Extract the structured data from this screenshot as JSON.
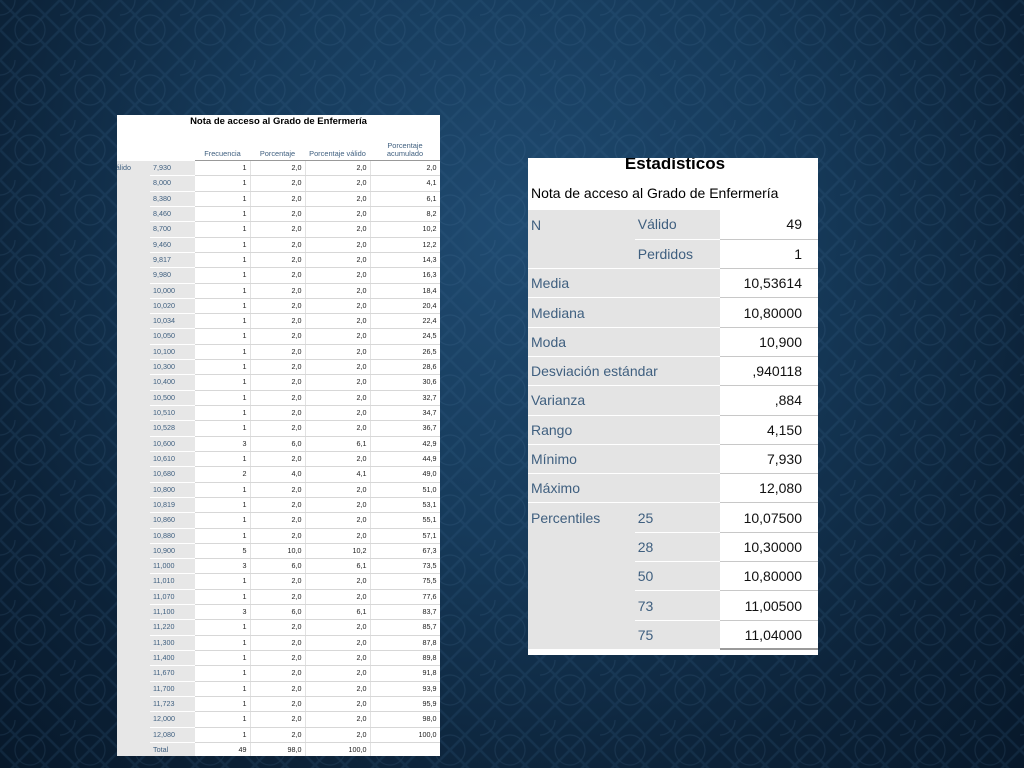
{
  "frequency_table": {
    "title": "Nota de acceso al Grado de Enfermería",
    "row_group_label": "Válido",
    "headers": [
      "Frecuencia",
      "Porcentaje",
      "Porcentaje válido",
      "Porcentaje acumulado"
    ],
    "rows": [
      {
        "value": "7,930",
        "freq": "1",
        "pct": "2,0",
        "valid": "2,0",
        "cum": "2,0"
      },
      {
        "value": "8,000",
        "freq": "1",
        "pct": "2,0",
        "valid": "2,0",
        "cum": "4,1"
      },
      {
        "value": "8,380",
        "freq": "1",
        "pct": "2,0",
        "valid": "2,0",
        "cum": "6,1"
      },
      {
        "value": "8,460",
        "freq": "1",
        "pct": "2,0",
        "valid": "2,0",
        "cum": "8,2"
      },
      {
        "value": "8,700",
        "freq": "1",
        "pct": "2,0",
        "valid": "2,0",
        "cum": "10,2"
      },
      {
        "value": "9,460",
        "freq": "1",
        "pct": "2,0",
        "valid": "2,0",
        "cum": "12,2"
      },
      {
        "value": "9,817",
        "freq": "1",
        "pct": "2,0",
        "valid": "2,0",
        "cum": "14,3"
      },
      {
        "value": "9,980",
        "freq": "1",
        "pct": "2,0",
        "valid": "2,0",
        "cum": "16,3"
      },
      {
        "value": "10,000",
        "freq": "1",
        "pct": "2,0",
        "valid": "2,0",
        "cum": "18,4"
      },
      {
        "value": "10,020",
        "freq": "1",
        "pct": "2,0",
        "valid": "2,0",
        "cum": "20,4"
      },
      {
        "value": "10,034",
        "freq": "1",
        "pct": "2,0",
        "valid": "2,0",
        "cum": "22,4"
      },
      {
        "value": "10,050",
        "freq": "1",
        "pct": "2,0",
        "valid": "2,0",
        "cum": "24,5"
      },
      {
        "value": "10,100",
        "freq": "1",
        "pct": "2,0",
        "valid": "2,0",
        "cum": "26,5"
      },
      {
        "value": "10,300",
        "freq": "1",
        "pct": "2,0",
        "valid": "2,0",
        "cum": "28,6"
      },
      {
        "value": "10,400",
        "freq": "1",
        "pct": "2,0",
        "valid": "2,0",
        "cum": "30,6"
      },
      {
        "value": "10,500",
        "freq": "1",
        "pct": "2,0",
        "valid": "2,0",
        "cum": "32,7"
      },
      {
        "value": "10,510",
        "freq": "1",
        "pct": "2,0",
        "valid": "2,0",
        "cum": "34,7"
      },
      {
        "value": "10,528",
        "freq": "1",
        "pct": "2,0",
        "valid": "2,0",
        "cum": "36,7"
      },
      {
        "value": "10,600",
        "freq": "3",
        "pct": "6,0",
        "valid": "6,1",
        "cum": "42,9"
      },
      {
        "value": "10,610",
        "freq": "1",
        "pct": "2,0",
        "valid": "2,0",
        "cum": "44,9"
      },
      {
        "value": "10,680",
        "freq": "2",
        "pct": "4,0",
        "valid": "4,1",
        "cum": "49,0"
      },
      {
        "value": "10,800",
        "freq": "1",
        "pct": "2,0",
        "valid": "2,0",
        "cum": "51,0"
      },
      {
        "value": "10,819",
        "freq": "1",
        "pct": "2,0",
        "valid": "2,0",
        "cum": "53,1"
      },
      {
        "value": "10,860",
        "freq": "1",
        "pct": "2,0",
        "valid": "2,0",
        "cum": "55,1"
      },
      {
        "value": "10,880",
        "freq": "1",
        "pct": "2,0",
        "valid": "2,0",
        "cum": "57,1"
      },
      {
        "value": "10,900",
        "freq": "5",
        "pct": "10,0",
        "valid": "10,2",
        "cum": "67,3"
      },
      {
        "value": "11,000",
        "freq": "3",
        "pct": "6,0",
        "valid": "6,1",
        "cum": "73,5"
      },
      {
        "value": "11,010",
        "freq": "1",
        "pct": "2,0",
        "valid": "2,0",
        "cum": "75,5"
      },
      {
        "value": "11,070",
        "freq": "1",
        "pct": "2,0",
        "valid": "2,0",
        "cum": "77,6"
      },
      {
        "value": "11,100",
        "freq": "3",
        "pct": "6,0",
        "valid": "6,1",
        "cum": "83,7"
      },
      {
        "value": "11,220",
        "freq": "1",
        "pct": "2,0",
        "valid": "2,0",
        "cum": "85,7"
      },
      {
        "value": "11,300",
        "freq": "1",
        "pct": "2,0",
        "valid": "2,0",
        "cum": "87,8"
      },
      {
        "value": "11,400",
        "freq": "1",
        "pct": "2,0",
        "valid": "2,0",
        "cum": "89,8"
      },
      {
        "value": "11,670",
        "freq": "1",
        "pct": "2,0",
        "valid": "2,0",
        "cum": "91,8"
      },
      {
        "value": "11,700",
        "freq": "1",
        "pct": "2,0",
        "valid": "2,0",
        "cum": "93,9"
      },
      {
        "value": "11,723",
        "freq": "1",
        "pct": "2,0",
        "valid": "2,0",
        "cum": "95,9"
      },
      {
        "value": "12,000",
        "freq": "1",
        "pct": "2,0",
        "valid": "2,0",
        "cum": "98,0"
      },
      {
        "value": "12,080",
        "freq": "1",
        "pct": "2,0",
        "valid": "2,0",
        "cum": "100,0"
      },
      {
        "value": "Total",
        "freq": "49",
        "pct": "98,0",
        "valid": "100,0",
        "cum": ""
      }
    ]
  },
  "statistics_table": {
    "title": "Estadísticos",
    "subtitle": "Nota de acceso al Grado de Enfermería",
    "n_label": "N",
    "n_valid_label": "Válido",
    "n_valid_value": "49",
    "n_missing_label": "Perdidos",
    "n_missing_value": "1",
    "rows": [
      {
        "label": "Media",
        "value": "10,53614"
      },
      {
        "label": "Mediana",
        "value": "10,80000"
      },
      {
        "label": "Moda",
        "value": "10,900"
      },
      {
        "label": "Desviación estándar",
        "value": ",940118"
      },
      {
        "label": "Varianza",
        "value": ",884"
      },
      {
        "label": "Rango",
        "value": "4,150"
      },
      {
        "label": "Mínimo",
        "value": "7,930"
      },
      {
        "label": "Máximo",
        "value": "12,080"
      }
    ],
    "percentiles_label": "Percentiles",
    "percentiles": [
      {
        "p": "25",
        "value": "10,07500"
      },
      {
        "p": "28",
        "value": "10,30000"
      },
      {
        "p": "50",
        "value": "10,80000"
      },
      {
        "p": "73",
        "value": "11,00500"
      },
      {
        "p": "75",
        "value": "11,04000"
      }
    ]
  }
}
